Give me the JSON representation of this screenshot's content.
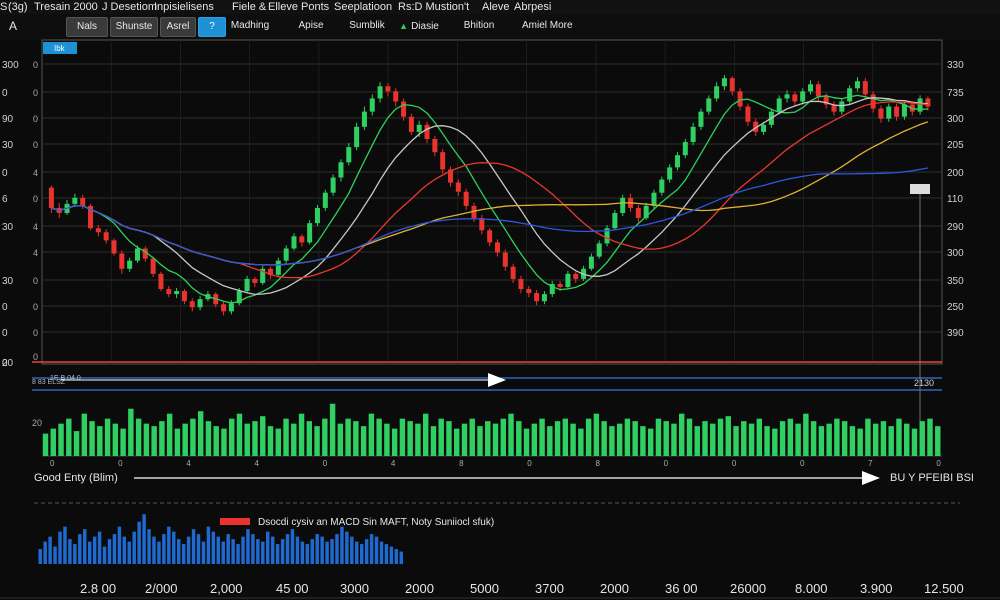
{
  "menu": [
    "(3g)",
    "Tresain 2000",
    "J Desetiom",
    "Inpisielisens",
    "Fiele &",
    "Elleve Ponts",
    "Seeplatioon",
    "Rs:D Mustion't",
    "Aleve",
    "Abrpesi"
  ],
  "menu_prefix": "S",
  "corner_label": "A",
  "toolbar": {
    "items": [
      "Nals",
      "Shunste",
      "Asrel",
      "?",
      "Madhing",
      "Apise",
      "Sumblik",
      "Diasie",
      "Bhition",
      "Amiel More"
    ],
    "active_index": 3,
    "indicator_icon": "triangle-up-icon"
  },
  "chart_data": [
    {
      "type": "candlestick",
      "badge": "Ibk",
      "left_axis_labels": [
        "300",
        "0",
        "90",
        "30",
        "0",
        "6",
        "30",
        "30",
        "0",
        "0",
        "0",
        "20"
      ],
      "left_ticks": [
        "0",
        "0",
        "0",
        "0",
        "4",
        "0",
        "4",
        "4",
        "0",
        "0",
        "0",
        "0"
      ],
      "right_axis_labels": [
        "330",
        "735",
        "300",
        "205",
        "200",
        "110",
        "290",
        "300",
        "350",
        "250",
        "390"
      ],
      "ohlc": [
        [
          230,
          210,
          232,
          205
        ],
        [
          210,
          205,
          215,
          200
        ],
        [
          205,
          214,
          218,
          203
        ],
        [
          214,
          220,
          224,
          211
        ],
        [
          220,
          212,
          223,
          209
        ],
        [
          212,
          190,
          214,
          188
        ],
        [
          190,
          186,
          193,
          182
        ],
        [
          186,
          178,
          189,
          175
        ],
        [
          178,
          165,
          180,
          163
        ],
        [
          165,
          150,
          168,
          145
        ],
        [
          150,
          158,
          161,
          147
        ],
        [
          158,
          170,
          173,
          156
        ],
        [
          170,
          160,
          172,
          157
        ],
        [
          160,
          145,
          162,
          142
        ],
        [
          145,
          130,
          147,
          128
        ],
        [
          130,
          125,
          133,
          122
        ],
        [
          125,
          128,
          131,
          121
        ],
        [
          128,
          118,
          130,
          115
        ],
        [
          118,
          112,
          121,
          108
        ],
        [
          112,
          120,
          123,
          109
        ],
        [
          120,
          125,
          128,
          118
        ],
        [
          125,
          115,
          127,
          112
        ],
        [
          115,
          108,
          118,
          104
        ],
        [
          108,
          116,
          119,
          105
        ],
        [
          116,
          128,
          131,
          114
        ],
        [
          128,
          140,
          143,
          126
        ],
        [
          140,
          136,
          142,
          132
        ],
        [
          136,
          150,
          153,
          134
        ],
        [
          150,
          144,
          152,
          140
        ],
        [
          144,
          158,
          161,
          142
        ],
        [
          158,
          170,
          173,
          155
        ],
        [
          170,
          182,
          185,
          168
        ],
        [
          182,
          176,
          184,
          172
        ],
        [
          176,
          195,
          198,
          174
        ],
        [
          195,
          210,
          213,
          192
        ],
        [
          210,
          225,
          228,
          207
        ],
        [
          225,
          240,
          243,
          222
        ],
        [
          240,
          255,
          258,
          236
        ],
        [
          255,
          270,
          274,
          252
        ],
        [
          270,
          290,
          294,
          267
        ],
        [
          290,
          305,
          310,
          287
        ],
        [
          305,
          318,
          322,
          301
        ],
        [
          318,
          330,
          334,
          314
        ],
        [
          330,
          325,
          333,
          320
        ],
        [
          325,
          315,
          328,
          310
        ],
        [
          315,
          300,
          318,
          296
        ],
        [
          300,
          285,
          303,
          282
        ],
        [
          285,
          292,
          296,
          280
        ],
        [
          292,
          278,
          295,
          274
        ],
        [
          278,
          265,
          281,
          261
        ],
        [
          265,
          248,
          268,
          244
        ],
        [
          248,
          235,
          251,
          231
        ],
        [
          235,
          226,
          238,
          222
        ],
        [
          226,
          212,
          229,
          208
        ],
        [
          212,
          200,
          215,
          196
        ],
        [
          200,
          188,
          203,
          184
        ],
        [
          188,
          176,
          190,
          172
        ],
        [
          176,
          166,
          179,
          162
        ],
        [
          166,
          152,
          169,
          148
        ],
        [
          152,
          140,
          155,
          136
        ],
        [
          140,
          130,
          143,
          126
        ],
        [
          130,
          126,
          133,
          122
        ],
        [
          126,
          118,
          129,
          114
        ],
        [
          118,
          125,
          128,
          115
        ],
        [
          125,
          135,
          138,
          122
        ],
        [
          135,
          132,
          138,
          128
        ],
        [
          132,
          145,
          148,
          130
        ],
        [
          145,
          140,
          147,
          136
        ],
        [
          140,
          150,
          153,
          138
        ],
        [
          150,
          162,
          165,
          148
        ],
        [
          162,
          175,
          178,
          160
        ],
        [
          175,
          190,
          193,
          172
        ],
        [
          190,
          205,
          208,
          188
        ],
        [
          205,
          220,
          223,
          202
        ],
        [
          220,
          210,
          224,
          206
        ],
        [
          210,
          200,
          213,
          196
        ],
        [
          200,
          212,
          215,
          198
        ],
        [
          212,
          225,
          228,
          209
        ],
        [
          225,
          238,
          241,
          222
        ],
        [
          238,
          250,
          253,
          235
        ],
        [
          250,
          262,
          265,
          247
        ],
        [
          262,
          275,
          278,
          259
        ],
        [
          275,
          290,
          294,
          272
        ],
        [
          290,
          305,
          308,
          287
        ],
        [
          305,
          318,
          321,
          302
        ],
        [
          318,
          330,
          334,
          315
        ],
        [
          330,
          338,
          341,
          326
        ],
        [
          338,
          325,
          340,
          321
        ],
        [
          325,
          310,
          328,
          306
        ],
        [
          310,
          295,
          313,
          291
        ],
        [
          295,
          285,
          298,
          281
        ],
        [
          285,
          292,
          295,
          282
        ],
        [
          292,
          305,
          308,
          289
        ],
        [
          305,
          318,
          321,
          302
        ],
        [
          318,
          322,
          326,
          314
        ],
        [
          322,
          315,
          325,
          311
        ],
        [
          315,
          325,
          328,
          312
        ],
        [
          325,
          332,
          336,
          322
        ],
        [
          332,
          320,
          335,
          316
        ],
        [
          320,
          312,
          323,
          308
        ],
        [
          312,
          305,
          315,
          301
        ],
        [
          305,
          315,
          318,
          302
        ],
        [
          315,
          328,
          331,
          312
        ],
        [
          328,
          335,
          339,
          325
        ],
        [
          335,
          322,
          338,
          318
        ],
        [
          322,
          308,
          325,
          304
        ],
        [
          308,
          298,
          311,
          294
        ],
        [
          298,
          310,
          313,
          295
        ],
        [
          310,
          300,
          313,
          296
        ],
        [
          300,
          312,
          315,
          297
        ],
        [
          312,
          305,
          315,
          301
        ],
        [
          305,
          318,
          321,
          302
        ],
        [
          318,
          310,
          320,
          306
        ]
      ],
      "moving_averages": [
        {
          "color": "#2fd05a",
          "period": 7
        },
        {
          "color": "#c8c8c8",
          "period": 14
        },
        {
          "color": "#e8382e",
          "period": 25
        },
        {
          "color": "#e0b030",
          "period": 40
        },
        {
          "color": "#2e56e0",
          "period": 60
        }
      ],
      "horizontal_lines": [
        {
          "value": 110,
          "color": "#e8452e"
        },
        {
          "value": 96,
          "color": "#2e78e8"
        },
        {
          "value": 84,
          "color": "#2e78e8"
        }
      ],
      "right_marker_value": "2130",
      "left_small_labels": [
        "8 83 ELSZ",
        "1E B.04.0"
      ],
      "colors": {
        "up": "#2fcf62",
        "down": "#e8342c",
        "grid": "#3a3a3a",
        "background": "#0b0b0b"
      }
    },
    {
      "type": "bar",
      "name": "volume",
      "left_tick_label": "20",
      "x_ticks": [
        "0",
        "0",
        "4",
        "4",
        "0",
        "4",
        "8",
        "0",
        "8",
        "0",
        "0",
        "0",
        "7",
        "0"
      ],
      "values": [
        18,
        22,
        26,
        30,
        20,
        34,
        28,
        24,
        30,
        26,
        22,
        38,
        30,
        26,
        24,
        28,
        34,
        22,
        26,
        30,
        36,
        28,
        24,
        22,
        30,
        34,
        26,
        28,
        32,
        24,
        22,
        30,
        26,
        34,
        28,
        24,
        30,
        42,
        26,
        30,
        28,
        24,
        34,
        30,
        26,
        22,
        30,
        28,
        26,
        34,
        24,
        30,
        28,
        22,
        26,
        30,
        24,
        28,
        26,
        30,
        34,
        28,
        22,
        26,
        30,
        24,
        28,
        30,
        26,
        22,
        30,
        34,
        28,
        24,
        26,
        30,
        28,
        24,
        22,
        30,
        28,
        26,
        34,
        30,
        24,
        28,
        26,
        30,
        32,
        24,
        28,
        26,
        30,
        24,
        22,
        28,
        30,
        26,
        34,
        28,
        24,
        26,
        30,
        28,
        24,
        22,
        30,
        26,
        28,
        24,
        30,
        26,
        22,
        28,
        30,
        24
      ],
      "color": "#2fcf62"
    },
    {
      "type": "bar",
      "name": "macd",
      "legend": "Dsocdi cysiv an MACD Sin MAFT, Noty Suniiocl sfuk)",
      "legend_color": "#e8342c",
      "values": [
        12,
        18,
        22,
        14,
        26,
        30,
        20,
        16,
        24,
        28,
        18,
        22,
        26,
        14,
        20,
        24,
        30,
        22,
        18,
        26,
        34,
        40,
        28,
        22,
        18,
        24,
        30,
        26,
        20,
        16,
        22,
        28,
        24,
        18,
        30,
        26,
        22,
        18,
        24,
        20,
        16,
        22,
        28,
        24,
        20,
        18,
        26,
        22,
        16,
        20,
        24,
        28,
        22,
        18,
        16,
        20,
        24,
        22,
        18,
        20,
        24,
        30,
        26,
        22,
        18,
        16,
        20,
        24,
        22,
        18,
        16,
        14,
        12,
        10
      ],
      "color": "#1e6ad0"
    }
  ],
  "arrows": {
    "upper_left_labels": [
      "8 83 ELSZ",
      "1E B.04.0"
    ],
    "signal_left": "Good Enty (Blim)",
    "signal_right": "BU Y PFEIBI BSI"
  },
  "x_axis_labels": [
    "2.8 00",
    "2/000",
    "2,000",
    "45 00",
    "3000",
    "2000",
    "5000",
    "3700",
    "2000",
    "36 00",
    "26000",
    "8.000",
    "3.900",
    "12.500"
  ]
}
